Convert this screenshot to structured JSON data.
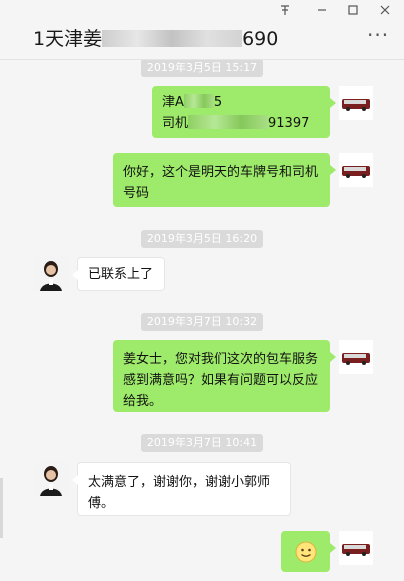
{
  "window": {
    "title_prefix": "1天津姜",
    "title_suffix": "690",
    "pin_icon": "pin-icon",
    "minimize_icon": "minimize-icon",
    "maximize_icon": "maximize-icon",
    "close_icon": "close-icon",
    "more_icon": "more-icon"
  },
  "messages": [
    {
      "id": "m1",
      "sender": "me",
      "line1_prefix": "津A",
      "line1_suffix": "5",
      "line2_prefix": "司机",
      "line2_suffix": "91397"
    },
    {
      "id": "m2",
      "sender": "me",
      "text": "你好，这个是明天的车牌号和司机号码"
    },
    {
      "id": "t1",
      "timestamp": "2019年3月5日 16:20"
    },
    {
      "id": "m3",
      "sender": "them",
      "text": "已联系上了"
    },
    {
      "id": "t2",
      "timestamp": "2019年3月7日 10:32"
    },
    {
      "id": "m4",
      "sender": "me",
      "text": "姜女士，您对我们这次的包车服务感到满意吗？如果有问题可以反应给我。"
    },
    {
      "id": "t3",
      "timestamp": "2019年3月7日 10:41"
    },
    {
      "id": "m5",
      "sender": "them",
      "text": "太满意了，谢谢你，谢谢小郭师傅。"
    },
    {
      "id": "m6",
      "sender": "me",
      "emoji": "slightly-smiling-face"
    }
  ],
  "partial_timestamp": "2019年3月5日 15:17"
}
